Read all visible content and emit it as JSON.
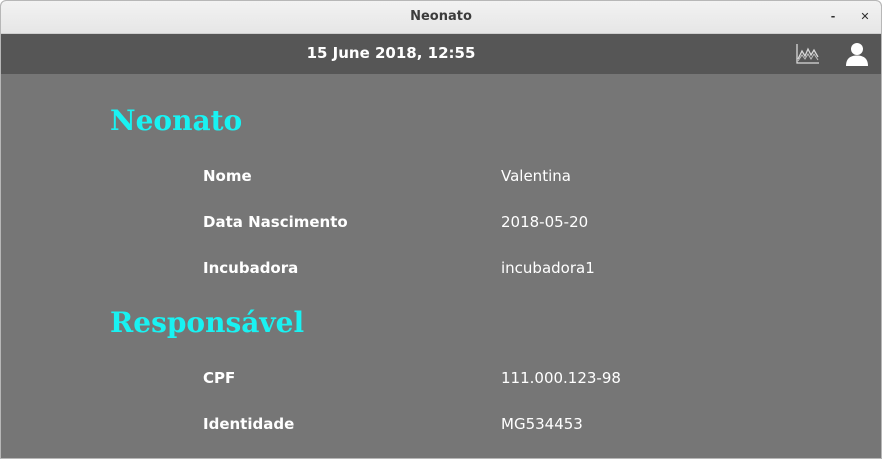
{
  "window": {
    "title": "Neonato",
    "minimize_label": "-",
    "close_label": "✕"
  },
  "header": {
    "datetime": "15 June 2018, 12:55",
    "icons": [
      "chart-icon",
      "user-icon"
    ]
  },
  "neonato": {
    "title": "Neonato",
    "rows": [
      {
        "label": "Nome",
        "value": "Valentina"
      },
      {
        "label": "Data Nascimento",
        "value": "2018-05-20"
      },
      {
        "label": "Incubadora",
        "value": "incubadora1"
      }
    ]
  },
  "responsavel": {
    "title": "Responsável",
    "rows": [
      {
        "label": "CPF",
        "value": "111.000.123-98"
      },
      {
        "label": "Identidade",
        "value": "MG534453"
      }
    ]
  },
  "colors": {
    "background": "#767676",
    "appbar": "#565656",
    "section_title": "#19f2f2",
    "text": "#ffffff"
  }
}
